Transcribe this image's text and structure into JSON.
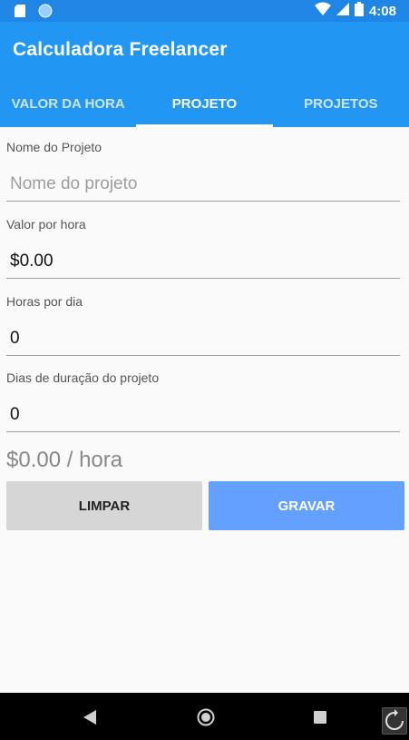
{
  "status_bar": {
    "time": "4:08",
    "icons": [
      "sd-card-icon",
      "sync-icon",
      "wifi-icon",
      "signal-icon",
      "battery-icon"
    ]
  },
  "app": {
    "title": "Calculadora Freelancer",
    "accent_color": "#2196f3"
  },
  "tabs": [
    {
      "label": "VALOR DA HORA",
      "active": false
    },
    {
      "label": "PROJETO",
      "active": true
    },
    {
      "label": "PROJETOS",
      "active": false
    }
  ],
  "form": {
    "project_name": {
      "label": "Nome do Projeto",
      "value": "",
      "placeholder": "Nome do projeto"
    },
    "hourly_rate": {
      "label": "Valor por hora",
      "value": "$0.00"
    },
    "hours_per_day": {
      "label": "Horas por dia",
      "value": "0"
    },
    "project_days": {
      "label": "Dias de duração do projeto",
      "value": "0"
    }
  },
  "result": {
    "rate_text": "$0.00 / hora"
  },
  "buttons": {
    "clear_label": "LIMPAR",
    "save_label": "GRAVAR"
  }
}
